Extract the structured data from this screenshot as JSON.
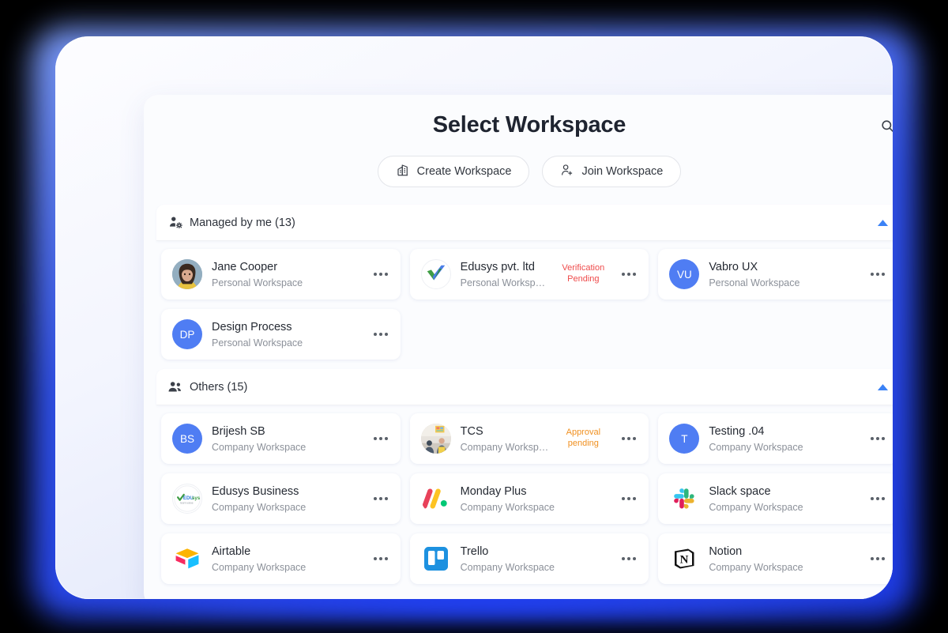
{
  "header": {
    "title": "Select Workspace",
    "search_icon": "search-icon",
    "create_label": "Create Workspace",
    "create_icon": "building-icon",
    "join_label": "Join Workspace",
    "join_icon": "person-add-icon"
  },
  "colors": {
    "accent": "#4F7DF3",
    "collapse_arrow": "#3b82f6",
    "verification_badge": "#ef4b4b",
    "approval_badge": "#f09020",
    "title": "#1f2430",
    "subtitle": "#8b9099",
    "device_bg": "#e9edfb",
    "page_bg": "#000000",
    "glow": "#2340f0"
  },
  "sections": [
    {
      "id": "managed-by-me",
      "title": "Managed by me (13)",
      "icon": "person-gear-icon",
      "collapse_icon": "triangle-up-icon",
      "expanded": true,
      "cards": [
        {
          "name": "Jane Cooper",
          "subtitle": "Personal Workspace",
          "avatar_type": "photo",
          "avatar_kind": "woman-photo",
          "initials": "",
          "badge": "",
          "badge_type": "",
          "menu_icon": "more-horizontal-icon"
        },
        {
          "name": "Edusys pvt. ltd",
          "subtitle": "Personal Workspace",
          "avatar_type": "logo",
          "avatar_kind": "edusys-check-logo",
          "initials": "",
          "badge": "Verification Pending",
          "badge_type": "verification",
          "menu_icon": "more-horizontal-icon"
        },
        {
          "name": "Vabro UX",
          "subtitle": "Personal Workspace",
          "avatar_type": "initials",
          "avatar_kind": "initials-avatar",
          "initials": "VU",
          "badge": "",
          "badge_type": "",
          "menu_icon": "more-horizontal-icon"
        },
        {
          "name": "Design Process",
          "subtitle": "Personal Workspace",
          "avatar_type": "initials",
          "avatar_kind": "initials-avatar",
          "initials": "DP",
          "badge": "",
          "badge_type": "",
          "menu_icon": "more-horizontal-icon"
        }
      ]
    },
    {
      "id": "others",
      "title": "Others (15)",
      "icon": "people-group-icon",
      "collapse_icon": "triangle-up-icon",
      "expanded": true,
      "cards": [
        {
          "name": "Brijesh SB",
          "subtitle": "Company Workspace",
          "avatar_type": "initials",
          "avatar_kind": "initials-avatar",
          "initials": "BS",
          "badge": "",
          "badge_type": "",
          "menu_icon": "more-horizontal-icon"
        },
        {
          "name": "TCS",
          "subtitle": "Company Workspace",
          "avatar_type": "photo",
          "avatar_kind": "office-photo",
          "initials": "",
          "badge": "Approval pending",
          "badge_type": "approval",
          "menu_icon": "more-horizontal-icon"
        },
        {
          "name": "Testing .04",
          "subtitle": "Company Workspace",
          "avatar_type": "initials",
          "avatar_kind": "initials-avatar",
          "initials": "T",
          "badge": "",
          "badge_type": "",
          "menu_icon": "more-horizontal-icon"
        },
        {
          "name": "Edusys Business",
          "subtitle": "Company Workspace",
          "avatar_type": "logo",
          "avatar_kind": "edusys-business-logo",
          "initials": "",
          "badge": "",
          "badge_type": "",
          "menu_icon": "more-horizontal-icon"
        },
        {
          "name": "Monday Plus",
          "subtitle": "Company Workspace",
          "avatar_type": "logo",
          "avatar_kind": "monday-logo",
          "initials": "",
          "badge": "",
          "badge_type": "",
          "menu_icon": "more-horizontal-icon"
        },
        {
          "name": "Slack space",
          "subtitle": "Company Workspace",
          "avatar_type": "logo",
          "avatar_kind": "slack-logo",
          "initials": "",
          "badge": "",
          "badge_type": "",
          "menu_icon": "more-horizontal-icon"
        },
        {
          "name": "Airtable",
          "subtitle": "Company Workspace",
          "avatar_type": "logo",
          "avatar_kind": "airtable-logo",
          "initials": "",
          "badge": "",
          "badge_type": "",
          "menu_icon": "more-horizontal-icon"
        },
        {
          "name": "Trello",
          "subtitle": "Company Workspace",
          "avatar_type": "logo",
          "avatar_kind": "trello-logo",
          "initials": "",
          "badge": "",
          "badge_type": "",
          "menu_icon": "more-horizontal-icon"
        },
        {
          "name": "Notion",
          "subtitle": "Company Workspace",
          "avatar_type": "logo",
          "avatar_kind": "notion-logo",
          "initials": "",
          "badge": "",
          "badge_type": "",
          "menu_icon": "more-horizontal-icon"
        }
      ]
    }
  ]
}
